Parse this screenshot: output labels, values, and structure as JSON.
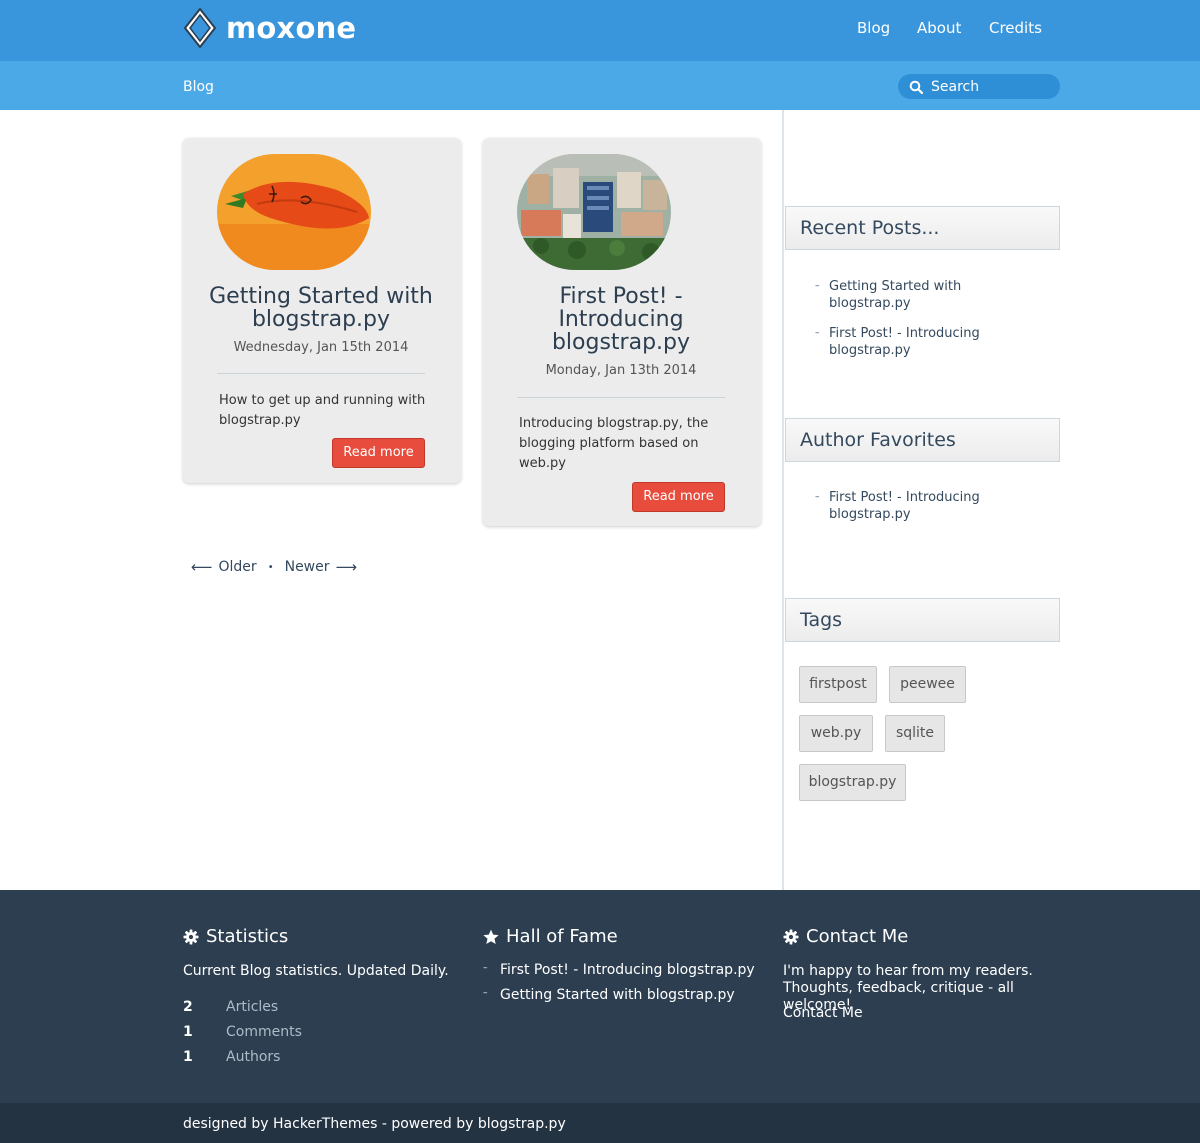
{
  "brand": {
    "name": "moxone",
    "logo_icon": "diamond-logo-icon"
  },
  "nav": {
    "items": [
      {
        "label": "Blog"
      },
      {
        "label": "About"
      },
      {
        "label": "Credits"
      }
    ]
  },
  "subnav": {
    "breadcrumb": "Blog",
    "search_placeholder": "Search",
    "search_icon": "search-icon"
  },
  "posts": [
    {
      "title": "Getting Started with blogstrap.py",
      "date": "Wednesday, Jan 15th 2014",
      "excerpt": "How to get up and running with blogstrap.py",
      "read_more": "Read more",
      "image": "carrot-photo"
    },
    {
      "title": "First Post! - Introducing blogstrap.py",
      "date": "Monday, Jan 13th 2014",
      "excerpt": "Introducing blogstrap.py, the blogging platform based on web.py",
      "read_more": "Read more",
      "image": "city-photo"
    }
  ],
  "pager": {
    "older": "Older",
    "newer": "Newer"
  },
  "sidebar": {
    "recent": {
      "title": "Recent Posts...",
      "items": [
        "Getting Started with blogstrap.py",
        "First Post! - Introducing blogstrap.py"
      ]
    },
    "favorites": {
      "title": "Author Favorites",
      "items": [
        "First Post! - Introducing blogstrap.py"
      ]
    },
    "tags": {
      "title": "Tags",
      "items": [
        "firstpost",
        "peewee",
        "web.py",
        "sqlite",
        "blogstrap.py"
      ]
    }
  },
  "footer": {
    "statistics": {
      "title": "Statistics",
      "icon": "gear-icon",
      "subtitle": "Current Blog statistics. Updated Daily.",
      "rows": [
        {
          "count": "2",
          "label": "Articles"
        },
        {
          "count": "1",
          "label": "Comments"
        },
        {
          "count": "1",
          "label": "Authors"
        }
      ]
    },
    "hall_of_fame": {
      "title": "Hall of Fame",
      "icon": "star-icon",
      "items": [
        "First Post! - Introducing blogstrap.py",
        "Getting Started with blogstrap.py"
      ]
    },
    "contact": {
      "title": "Contact Me",
      "icon": "gear-icon",
      "text": "I'm happy to hear from my readers. Thoughts, feedback, critique - all welcome!",
      "link": "Contact Me"
    },
    "credits": "designed by HackerThemes - powered by blogstrap.py"
  },
  "colors": {
    "navbar": "#3a96dc",
    "subbar": "#4ca9e8",
    "accent_button": "#e74c3c",
    "footer": "#2c3e50",
    "footer_bottom": "#243342"
  }
}
